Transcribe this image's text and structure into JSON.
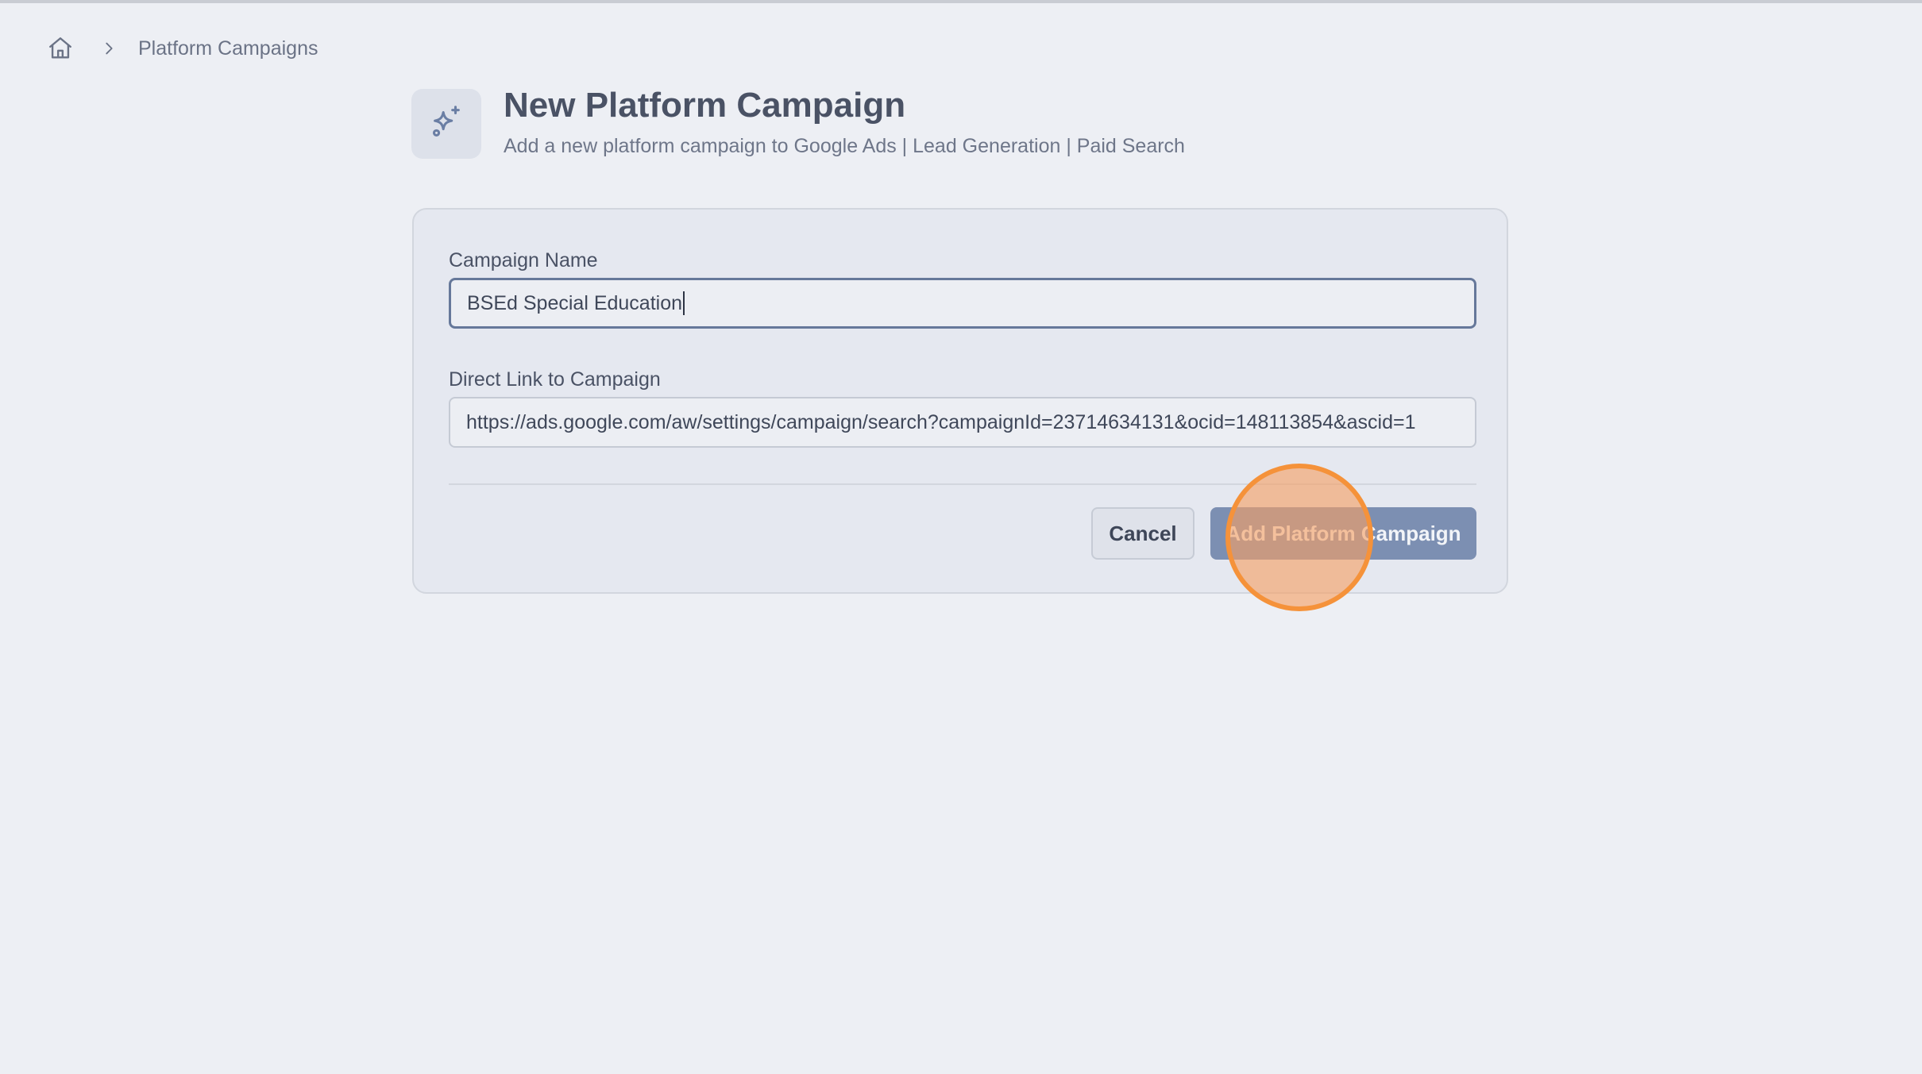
{
  "breadcrumb": {
    "home_icon": "home-icon",
    "separator_icon": "chevron-right-icon",
    "current": "Platform Campaigns"
  },
  "header": {
    "icon": "sparkles-icon",
    "title": "New Platform Campaign",
    "subtitle": "Add a new platform campaign to Google Ads | Lead Generation | Paid Search"
  },
  "form": {
    "campaign_name": {
      "label": "Campaign Name",
      "value": "BSEd Special Education",
      "focused": true
    },
    "direct_link": {
      "label": "Direct Link to Campaign",
      "value": "https://ads.google.com/aw/settings/campaign/search?campaignId=23714634131&ocid=148113854&ascid=1"
    },
    "actions": {
      "cancel_label": "Cancel",
      "submit_label": "Add Platform Campaign"
    }
  },
  "colors": {
    "background": "#edeff4",
    "card": "#e5e8f0",
    "primary_button": "#7c8fb2",
    "click_indicator": "#f5923a"
  }
}
